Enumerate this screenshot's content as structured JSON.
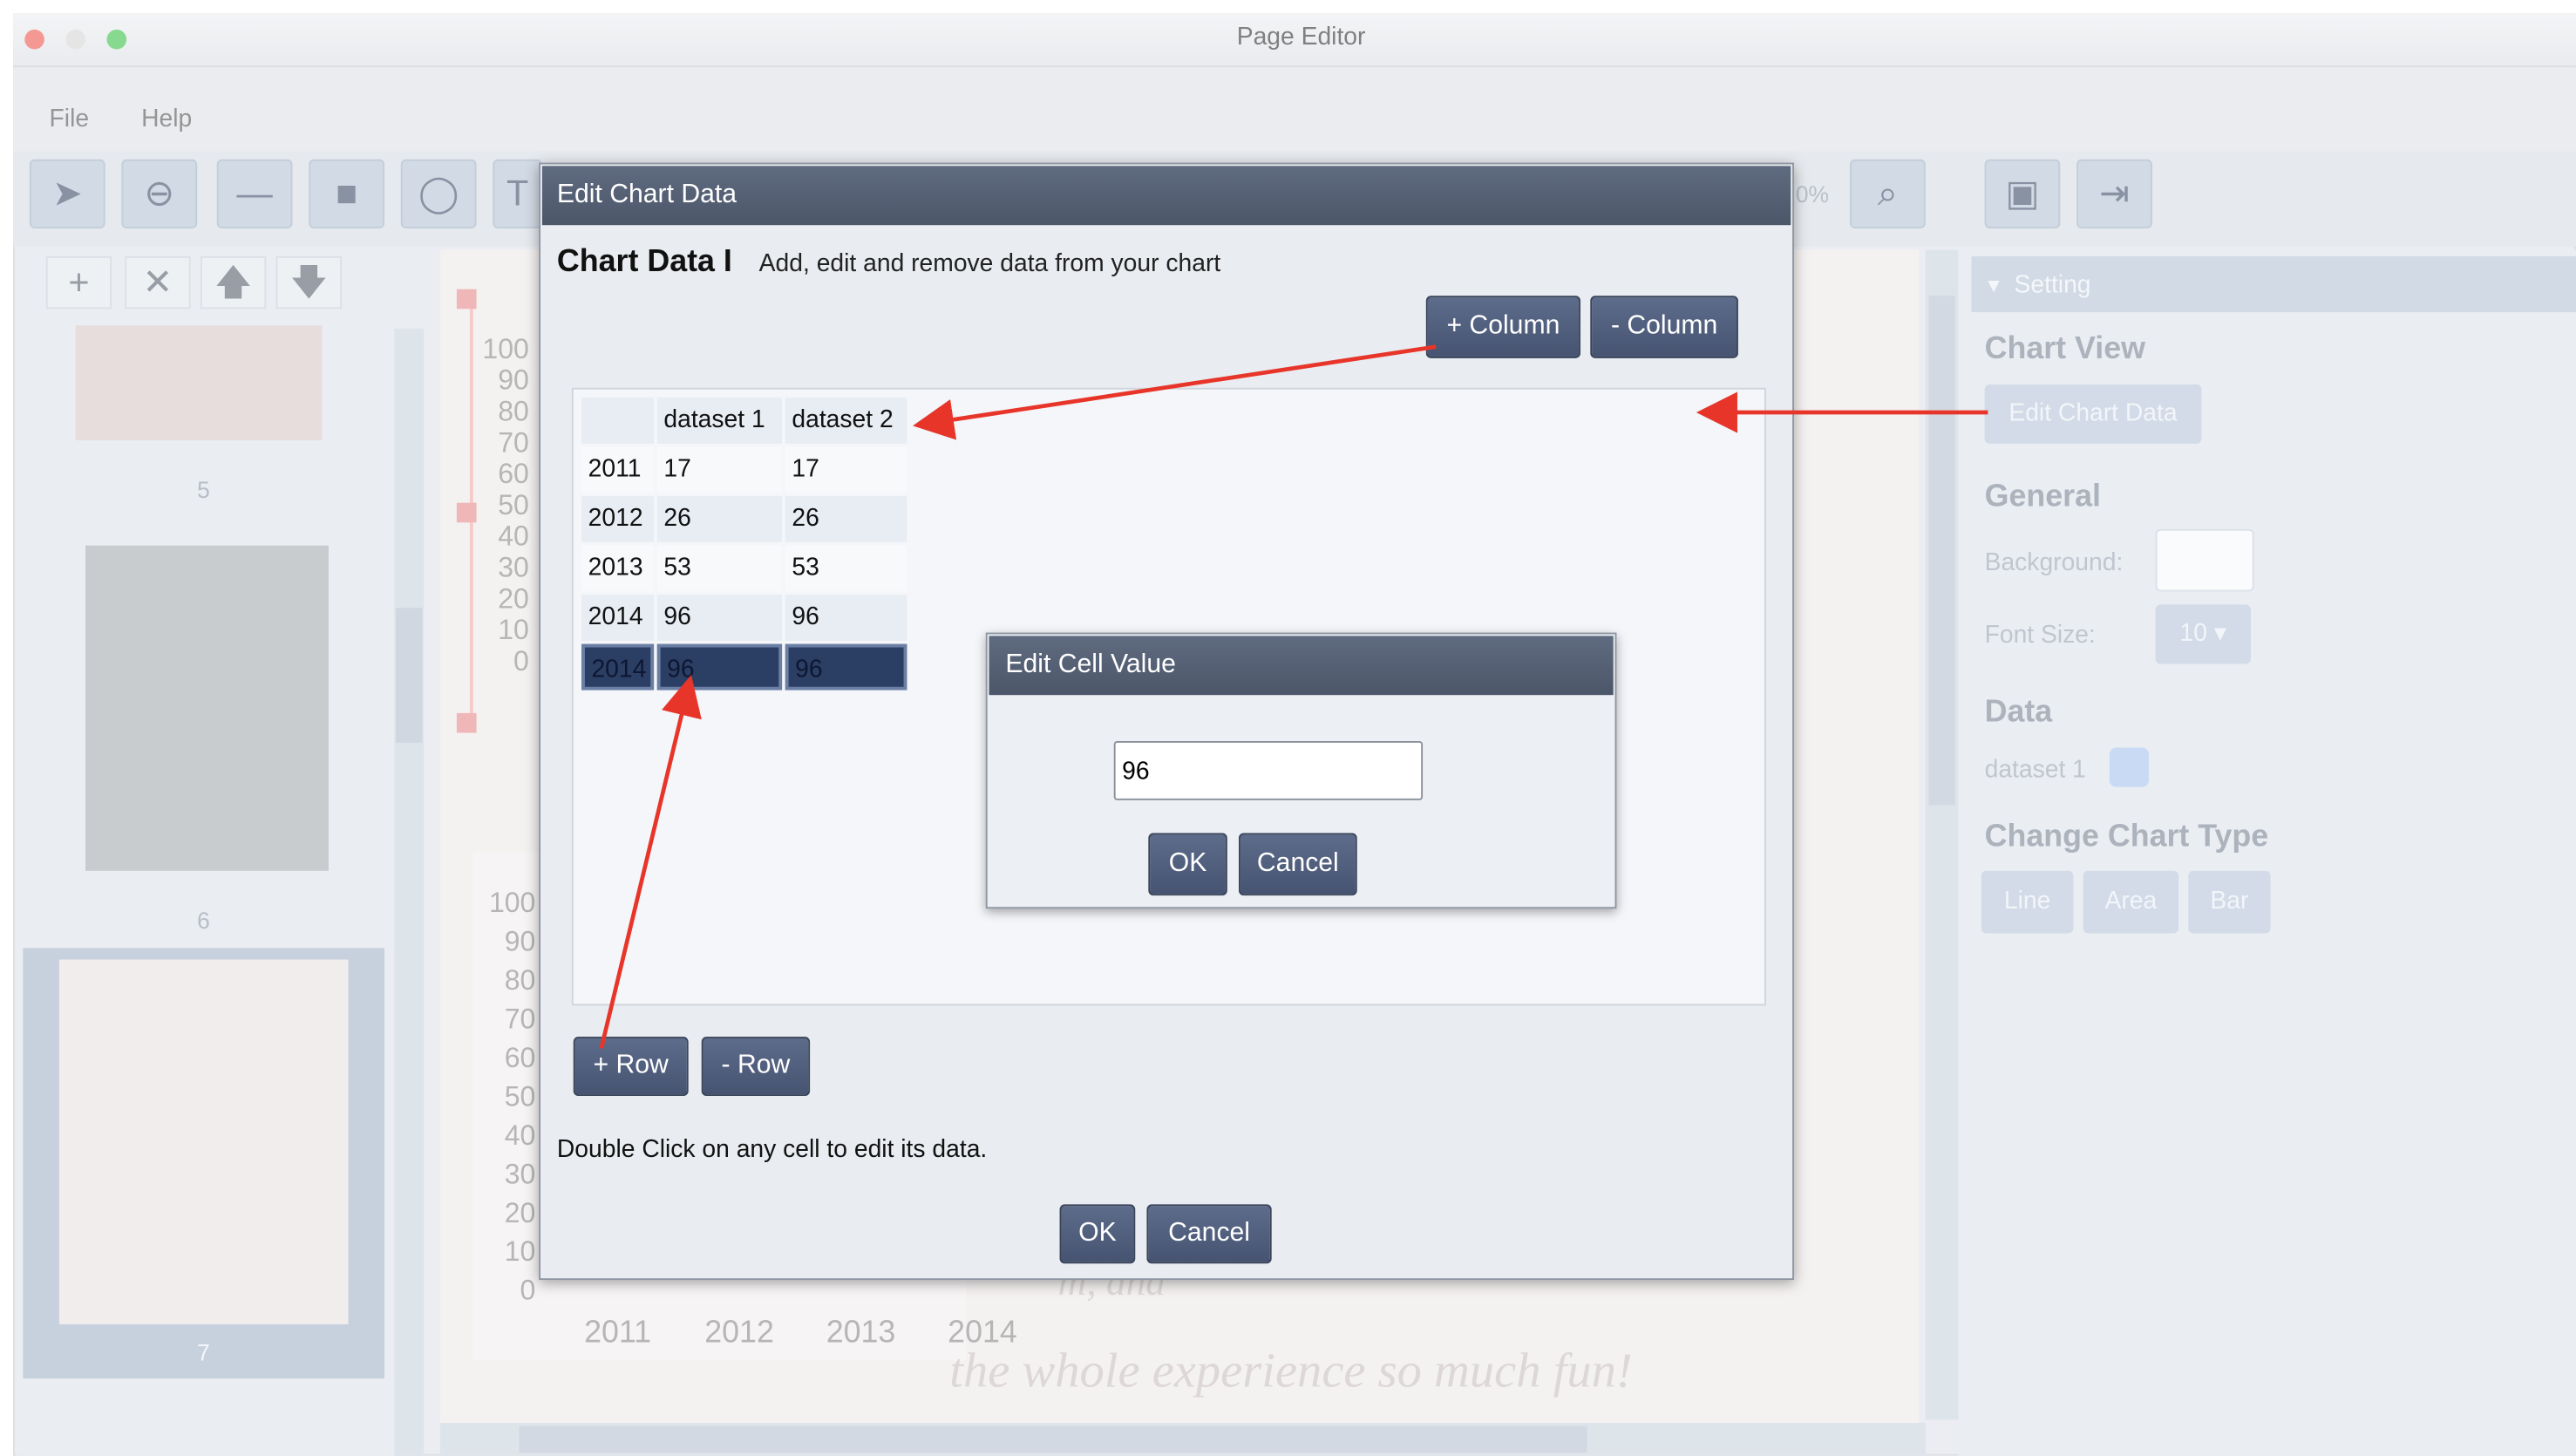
{
  "window": {
    "title": "Page Editor"
  },
  "menu": [
    "File",
    "Help"
  ],
  "toolbar": {
    "zoom_partial": "0%"
  },
  "pages": {
    "labels": [
      "5",
      "6",
      "7"
    ]
  },
  "background_chart": {
    "y_ticks_top": [
      "100",
      "90",
      "80",
      "70",
      "60",
      "50",
      "40",
      "30",
      "20",
      "10",
      "0"
    ],
    "y_ticks_bottom": [
      "100",
      "90",
      "80",
      "70",
      "60",
      "50",
      "40",
      "30",
      "20",
      "10",
      "0"
    ],
    "x_ticks": [
      "2011",
      "2012",
      "2013",
      "2014"
    ],
    "text_fragment": "m, and",
    "text_line": "the whole experience so much fun!"
  },
  "right_panel": {
    "setting": "Setting",
    "chart_view": "Chart View",
    "edit_chart_data": "Edit Chart Data",
    "general": "General",
    "background_label": "Background:",
    "font_size_label": "Font Size:",
    "font_size_value": "10",
    "data": "Data",
    "dataset_label": "dataset 1",
    "dataset_color": "#a9c6ee",
    "change_chart_type": "Change Chart Type",
    "types": [
      "Line",
      "Area",
      "Bar"
    ]
  },
  "dialog": {
    "title": "Edit Chart Data",
    "heading": "Chart Data I",
    "subtitle": "Add, edit and remove data from your chart",
    "add_column": "+ Column",
    "remove_column": "- Column",
    "add_row": "+ Row",
    "remove_row": "- Row",
    "hint": "Double Click on any cell to edit its data.",
    "ok": "OK",
    "cancel": "Cancel",
    "table": {
      "headers": [
        "",
        "dataset 1",
        "dataset 2"
      ],
      "rows": [
        [
          "2011",
          "17",
          "17"
        ],
        [
          "2012",
          "26",
          "26"
        ],
        [
          "2013",
          "53",
          "53"
        ],
        [
          "2014",
          "96",
          "96"
        ],
        [
          "2014",
          "96",
          "96"
        ]
      ]
    }
  },
  "cell_dialog": {
    "title": "Edit Cell Value",
    "value": "96",
    "ok": "OK",
    "cancel": "Cancel"
  },
  "colors": {
    "annotation_arrow": "#e8352a",
    "dialog_header": "#4f596c",
    "button": "#4e5c7a"
  }
}
